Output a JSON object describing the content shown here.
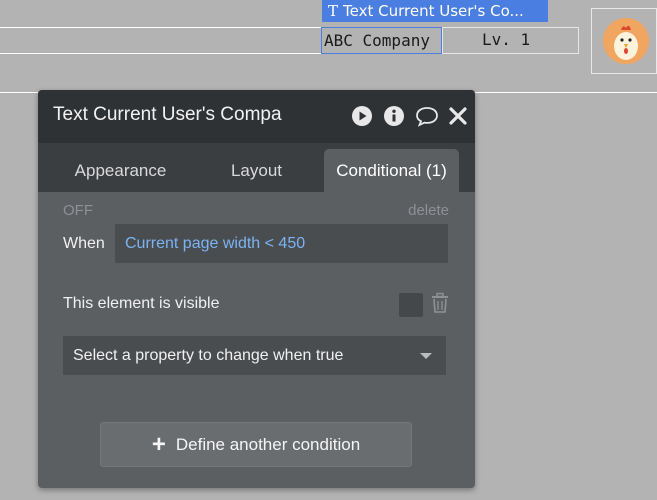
{
  "canvas": {
    "selected_tag": "Text Current User's Co...",
    "company_text": "ABC Company",
    "level_text": "Lv. 1"
  },
  "panel": {
    "title": "Text Current User's Compa",
    "header_icons": [
      "play-icon",
      "info-icon",
      "comment-icon",
      "close-icon"
    ],
    "tabs": [
      {
        "label": "Appearance"
      },
      {
        "label": "Layout"
      },
      {
        "label": "Conditional (1)"
      }
    ],
    "active_tab": "Conditional (1)",
    "condition": {
      "status": "OFF",
      "delete_label": "delete",
      "when_label": "When",
      "when_value": "Current page width < 450",
      "visible_label": "This element is visible",
      "property_select": "Select a property to change when true"
    },
    "define_button": "Define another condition"
  },
  "colors": {
    "canvas_bg": "#b3b3b3",
    "selection_blue": "#4a7ee0",
    "panel_bg": "#5c5f62",
    "header_bg": "#2f3235",
    "expression_blue": "#7cb3f2"
  }
}
